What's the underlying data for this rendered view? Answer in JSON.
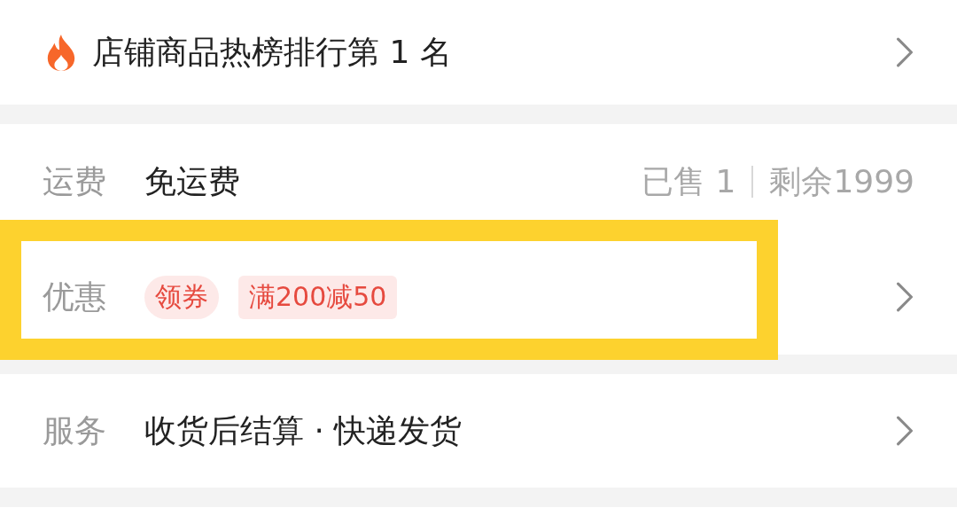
{
  "hot_rank": {
    "text": "店铺商品热榜排行第 1 名",
    "has_arrow": true
  },
  "sections": [
    {
      "rows": [
        {
          "kind": "text",
          "label": "运费",
          "value": "免运费",
          "sold": "已售 1",
          "remaining": "剩余1999",
          "has_arrow": false,
          "highlighted": false
        },
        {
          "kind": "tags",
          "label": "优惠",
          "tags": [
            {
              "text": "领券",
              "kind": "pill"
            },
            {
              "text": "满200减50",
              "kind": "rect"
            }
          ],
          "has_arrow": true,
          "highlighted": true
        }
      ]
    },
    {
      "rows": [
        {
          "kind": "text",
          "label": "服务",
          "value": "收货后结算 · 快递发货",
          "has_arrow": true,
          "highlighted": false
        }
      ]
    }
  ]
}
